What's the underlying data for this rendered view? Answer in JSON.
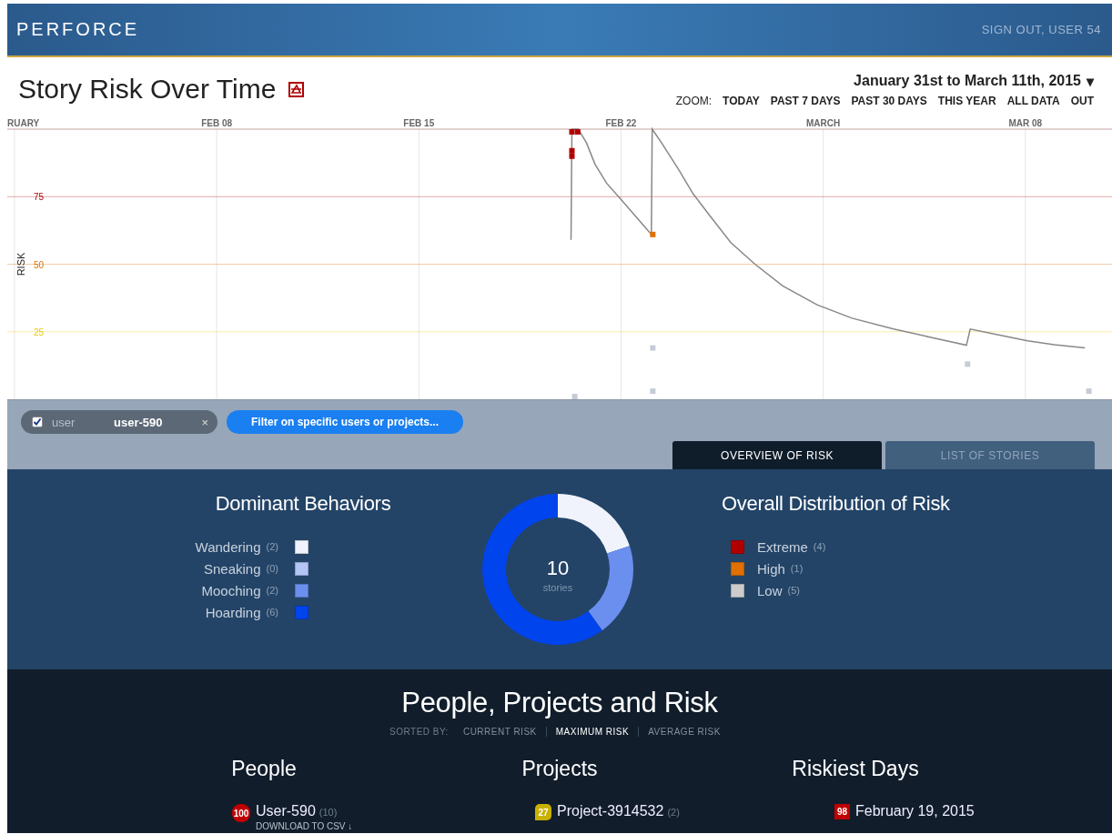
{
  "header": {
    "logo": "PERFORCE",
    "account_link": "SIGN OUT, USER 54"
  },
  "page": {
    "title": "Story Risk Over Time",
    "date_range": "January 31st to March 11th, 2015",
    "date_caret": "▾",
    "zoom_label": "ZOOM:",
    "zoom_options": [
      {
        "label": "TODAY"
      },
      {
        "label": "PAST 7 DAYS"
      },
      {
        "label": "PAST 30 DAYS"
      },
      {
        "label": "THIS YEAR"
      },
      {
        "label": "ALL DATA"
      },
      {
        "label": "OUT"
      }
    ]
  },
  "risk_chart": {
    "y_axis_label": "RISK",
    "x_labels": [
      "RUARY",
      "FEB 08",
      "FEB 15",
      "FEB 22",
      "MARCH",
      "MAR 08"
    ],
    "y_labels": [
      "75",
      "50",
      "25"
    ]
  },
  "filter_bar": {
    "chip": {
      "checked": true,
      "field": "user",
      "value": "user-590",
      "remove": "×"
    },
    "filter_button": "Filter on specific users or projects...",
    "tabs": [
      {
        "label": "OVERVIEW OF RISK",
        "selected": true
      },
      {
        "label": "LIST OF STORIES",
        "selected": false
      }
    ]
  },
  "overview": {
    "behaviors": {
      "title": "Dominant Behaviors",
      "items": [
        {
          "label": "Wandering",
          "count": "(2)",
          "color": "#f0f3fb"
        },
        {
          "label": "Sneaking",
          "count": "(0)",
          "color": "#b3c5f5"
        },
        {
          "label": "Mooching",
          "count": "(2)",
          "color": "#6b8fee"
        },
        {
          "label": "Hoarding",
          "count": "(6)",
          "color": "#0044ee"
        }
      ]
    },
    "donut": {
      "total": "10",
      "unit": "stories"
    },
    "distribution": {
      "title": "Overall Distribution of Risk",
      "items": [
        {
          "label": "Extreme",
          "count": "(4)",
          "color": "#b00000"
        },
        {
          "label": "High",
          "count": "(1)",
          "color": "#e07000"
        },
        {
          "label": "Low",
          "count": "(5)",
          "color": "#cccccc"
        }
      ]
    }
  },
  "ranking": {
    "title": "People, Projects and Risk",
    "sorted_by": "SORTED BY:",
    "sort_options": [
      {
        "label": "CURRENT RISK",
        "selected": false
      },
      {
        "label": "MAXIMUM RISK",
        "selected": true
      },
      {
        "label": "AVERAGE RISK",
        "selected": false
      }
    ],
    "columns": [
      {
        "title": "People",
        "items": [
          {
            "badge": "100",
            "kind": "circle",
            "color": "#c00000",
            "name": "User-590",
            "count": "(10)",
            "link": "DOWNLOAD TO CSV ↓"
          }
        ]
      },
      {
        "title": "Projects",
        "items": [
          {
            "badge": "27",
            "kind": "rounded",
            "color": "#c8b000",
            "name": "Project-3914532",
            "count": "(2)"
          }
        ]
      },
      {
        "title": "Riskiest Days",
        "items": [
          {
            "badge": "98",
            "kind": "square",
            "color": "#c00000",
            "name": "February 19, 2015"
          }
        ]
      }
    ]
  }
}
